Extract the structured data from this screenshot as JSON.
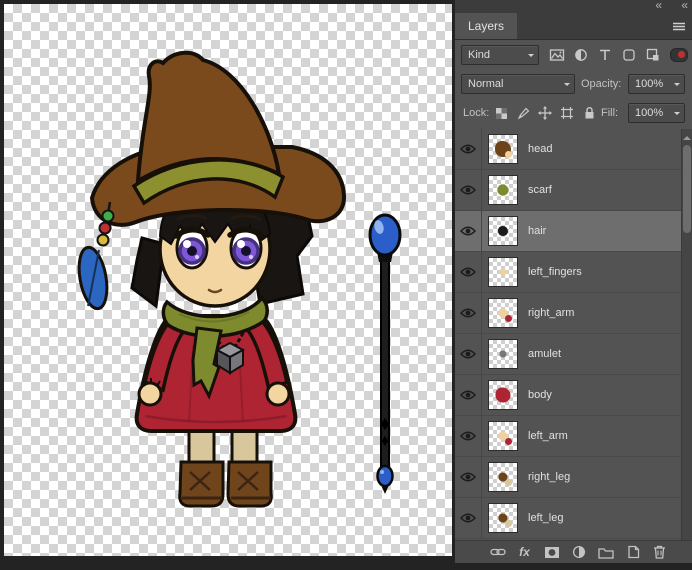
{
  "dock": {
    "collapse_glyph": "«"
  },
  "panel": {
    "tab_label": "Layers",
    "filter": {
      "kind_label": "Kind"
    },
    "blend": {
      "mode_value": "Normal",
      "opacity_label": "Opacity:",
      "opacity_value": "100%"
    },
    "lock": {
      "label": "Lock:",
      "fill_label": "Fill:",
      "fill_value": "100%"
    },
    "layers": [
      {
        "name": "head",
        "thumb_color": "#6d4419",
        "thumb_color2": "#f0d19e",
        "thumb_size": 16
      },
      {
        "name": "scarf",
        "thumb_color": "#7e8a2e",
        "thumb_size": 11
      },
      {
        "name": "hair",
        "thumb_color": "#1b1b1b",
        "thumb_size": 10,
        "selected": true
      },
      {
        "name": "left_fingers",
        "thumb_color": "#f0d19e",
        "thumb_size": 7
      },
      {
        "name": "right_arm",
        "thumb_color": "#f0d19e",
        "thumb_color2": "#ae2433",
        "thumb_size": 9
      },
      {
        "name": "amulet",
        "thumb_color": "#77777c",
        "thumb_size": 7
      },
      {
        "name": "body",
        "thumb_color": "#ae2433",
        "thumb_size": 15
      },
      {
        "name": "left_arm",
        "thumb_color": "#f0d19e",
        "thumb_color2": "#ae2433",
        "thumb_size": 9
      },
      {
        "name": "right_leg",
        "thumb_color": "#6d4419",
        "thumb_color2": "#d8c69c",
        "thumb_size": 9
      },
      {
        "name": "left_leg",
        "thumb_color": "#6d4419",
        "thumb_color2": "#d8c69c",
        "thumb_size": 9
      }
    ],
    "bottom_bar": {
      "fx_label": "fx"
    }
  },
  "art": {
    "hat": "#7b4a1c",
    "hat_dark": "#563212",
    "band": "#8d902f",
    "skin": "#f2d5a0",
    "hair": "#191512",
    "eye_iris": "#7e57d6",
    "eye_dark": "#46307f",
    "scarf": "#7e8a2e",
    "scarf_dark": "#5f6a1f",
    "dress": "#ae2433",
    "dress_dark": "#821a26",
    "boot": "#70451c",
    "sock": "#d8c69c",
    "staff_orb": "#2b5ec9",
    "feather": "#2b66c0",
    "bead_green": "#3fae4a",
    "bead_red": "#c03030",
    "bead_yellow": "#d9b93b",
    "outline": "#161008"
  }
}
